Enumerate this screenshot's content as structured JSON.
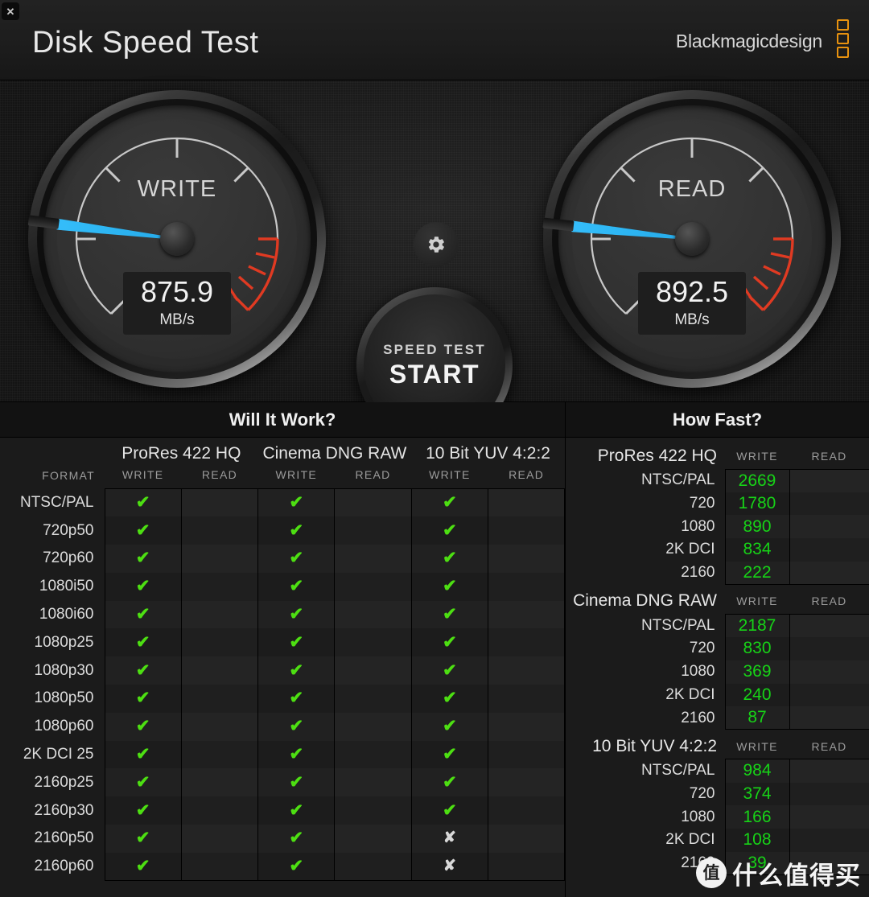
{
  "window": {
    "close_label": "✕"
  },
  "header": {
    "title": "Disk Speed Test",
    "brand": "Blackmagicdesign"
  },
  "gauges": {
    "write": {
      "label": "WRITE",
      "value": "875.9",
      "unit": "MB/s",
      "needle_angle_deg": 187,
      "needle_color": "#2fb8f5"
    },
    "read": {
      "label": "READ",
      "value": "892.5",
      "unit": "MB/s",
      "needle_angle_deg": 186,
      "needle_color": "#2fb8f5"
    }
  },
  "controls": {
    "gear_icon": "gear-icon",
    "start_line1": "SPEED TEST",
    "start_line2": "START"
  },
  "will_it_work": {
    "title": "Will It Work?",
    "format_label": "FORMAT",
    "groups": [
      "ProRes 422 HQ",
      "Cinema DNG RAW",
      "10 Bit YUV 4:2:2"
    ],
    "sub_headers": [
      "WRITE",
      "READ"
    ],
    "ok_glyph": "✔",
    "fail_glyph": "✘",
    "rows": [
      {
        "format": "NTSC/PAL",
        "cells": [
          "ok",
          "",
          "ok",
          "",
          "ok",
          ""
        ]
      },
      {
        "format": "720p50",
        "cells": [
          "ok",
          "",
          "ok",
          "",
          "ok",
          ""
        ]
      },
      {
        "format": "720p60",
        "cells": [
          "ok",
          "",
          "ok",
          "",
          "ok",
          ""
        ]
      },
      {
        "format": "1080i50",
        "cells": [
          "ok",
          "",
          "ok",
          "",
          "ok",
          ""
        ]
      },
      {
        "format": "1080i60",
        "cells": [
          "ok",
          "",
          "ok",
          "",
          "ok",
          ""
        ]
      },
      {
        "format": "1080p25",
        "cells": [
          "ok",
          "",
          "ok",
          "",
          "ok",
          ""
        ]
      },
      {
        "format": "1080p30",
        "cells": [
          "ok",
          "",
          "ok",
          "",
          "ok",
          ""
        ]
      },
      {
        "format": "1080p50",
        "cells": [
          "ok",
          "",
          "ok",
          "",
          "ok",
          ""
        ]
      },
      {
        "format": "1080p60",
        "cells": [
          "ok",
          "",
          "ok",
          "",
          "ok",
          ""
        ]
      },
      {
        "format": "2K DCI 25",
        "cells": [
          "ok",
          "",
          "ok",
          "",
          "ok",
          ""
        ]
      },
      {
        "format": "2160p25",
        "cells": [
          "ok",
          "",
          "ok",
          "",
          "ok",
          ""
        ]
      },
      {
        "format": "2160p30",
        "cells": [
          "ok",
          "",
          "ok",
          "",
          "ok",
          ""
        ]
      },
      {
        "format": "2160p50",
        "cells": [
          "ok",
          "",
          "ok",
          "",
          "no",
          ""
        ]
      },
      {
        "format": "2160p60",
        "cells": [
          "ok",
          "",
          "ok",
          "",
          "no",
          ""
        ]
      }
    ]
  },
  "how_fast": {
    "title": "How Fast?",
    "sub_headers": [
      "WRITE",
      "READ"
    ],
    "groups": [
      {
        "name": "ProRes 422 HQ",
        "rows": [
          {
            "label": "NTSC/PAL",
            "write": "2669",
            "read": ""
          },
          {
            "label": "720",
            "write": "1780",
            "read": ""
          },
          {
            "label": "1080",
            "write": "890",
            "read": ""
          },
          {
            "label": "2K DCI",
            "write": "834",
            "read": ""
          },
          {
            "label": "2160",
            "write": "222",
            "read": ""
          }
        ]
      },
      {
        "name": "Cinema DNG RAW",
        "rows": [
          {
            "label": "NTSC/PAL",
            "write": "2187",
            "read": ""
          },
          {
            "label": "720",
            "write": "830",
            "read": ""
          },
          {
            "label": "1080",
            "write": "369",
            "read": ""
          },
          {
            "label": "2K DCI",
            "write": "240",
            "read": ""
          },
          {
            "label": "2160",
            "write": "87",
            "read": ""
          }
        ]
      },
      {
        "name": "10 Bit YUV 4:2:2",
        "rows": [
          {
            "label": "NTSC/PAL",
            "write": "984",
            "read": ""
          },
          {
            "label": "720",
            "write": "374",
            "read": ""
          },
          {
            "label": "1080",
            "write": "166",
            "read": ""
          },
          {
            "label": "2K DCI",
            "write": "108",
            "read": ""
          },
          {
            "label": "2160",
            "write": "39",
            "read": ""
          }
        ]
      }
    ]
  },
  "watermark": {
    "logo": "值",
    "text": "什么值得买"
  },
  "colors": {
    "accent_orange": "#e8920f",
    "needle_blue": "#2fb8f5",
    "value_green": "#17d317",
    "check_green": "#4ddf12",
    "redzone": "#e03a22"
  }
}
